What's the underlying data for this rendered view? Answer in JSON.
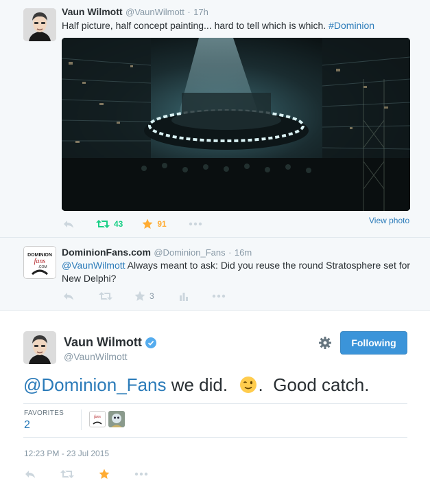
{
  "tweet1": {
    "name": "Vaun Wilmott",
    "handle": "@VaunWilmott",
    "sep": "·",
    "time": "17h",
    "text": "Half picture, half concept painting... hard to tell which is which.",
    "hashtag": "#Dominion",
    "retweets": "43",
    "favorites": "91",
    "view_photo": "View photo"
  },
  "tweet2": {
    "name": "DominionFans.com",
    "handle": "@Dominion_Fans",
    "sep": "·",
    "time": "16m",
    "mention": "@VaunWilmott",
    "text": "Always meant to ask: Did you reuse the round Stratosphere set for New Delphi?",
    "favorites": "3",
    "logo_text": "DominionFans.com"
  },
  "main": {
    "name": "Vaun Wilmott",
    "handle": "@VaunWilmott",
    "follow_label": "Following",
    "mention": "@Dominion_Fans",
    "text_a": " we did.  ",
    "text_b": ".  Good catch.",
    "fav_label": "FAVORITES",
    "fav_count": "2",
    "timestamp": "12:23 PM - 23 Jul 2015"
  },
  "colors": {
    "link": "#2b7bb9",
    "retweet_on": "#19cf86",
    "favorite_on": "#ffac33",
    "follow_button": "#3b94d9",
    "verified": "#55acee"
  }
}
